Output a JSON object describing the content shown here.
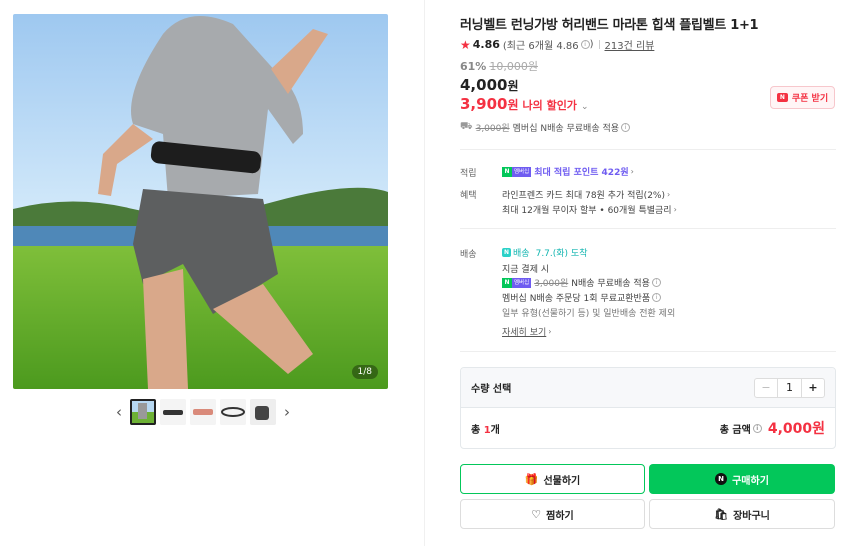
{
  "gallery": {
    "counter": "1/8",
    "prev_arrow": "‹",
    "next_arrow": "›"
  },
  "product": {
    "title": "러닝벨트 런닝가방 허리밴드 마라톤 힙색 플립벨트 1+1",
    "rating": "4.86",
    "rating_recent": "(최근 6개월 4.86",
    "rating_recent_close": ")",
    "review_count": "213건 리뷰",
    "discount_pct": "61%",
    "original_price": "10,000원",
    "price": "4,000",
    "price_unit": "원",
    "member_price": "3,900",
    "member_price_unit": "원",
    "member_price_label": "나의 할인가",
    "coupon_label": "쿠폰 받기",
    "shipping_strike": "3,000원",
    "shipping_text": "멤버십 N배송 무료배송 적용"
  },
  "benefits": {
    "points_label": "적립",
    "points_text": "최대 적립 포인트 422원",
    "perks_label": "혜택",
    "perk_1": "라인프렌즈 카드 최대 78원 추가 적립(2%)",
    "perk_2": "최대 12개월 무이자 할부 • 60개월 특별금리"
  },
  "delivery": {
    "label": "배송",
    "badge": "N",
    "badge_text": "배송",
    "eta": "7.7.(화) 도착",
    "pay_now": "지금 결제 시",
    "free_strike": "3,000원",
    "free_text": "N배송 무료배송 적용",
    "exchange": "멤버십 N배송 주문당 1회 무료교환반품",
    "note": "일부 유형(선물하기 등) 및 일반배송 전환 제외",
    "more": "자세히 보기"
  },
  "membership_badge": "멤버십",
  "quantity": {
    "label": "수량 선택",
    "minus": "−",
    "value": "1",
    "plus": "+",
    "total_prefix": "총 ",
    "total_count": "1",
    "total_suffix": "개",
    "total_label": "총 금액",
    "total_amount": "4,000원"
  },
  "buttons": {
    "gift": "선물하기",
    "buy": "구매하기",
    "wish": "찜하기",
    "cart": "장바구니"
  }
}
